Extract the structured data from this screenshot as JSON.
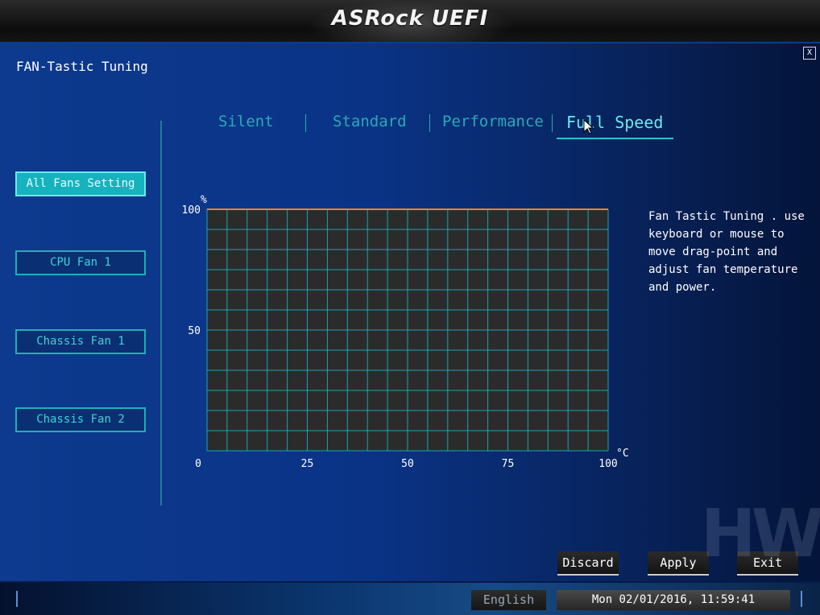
{
  "header": {
    "logo_text": "ASRock UEFI"
  },
  "page": {
    "title": "FAN-Tastic Tuning",
    "close_label": "X"
  },
  "sidebar": {
    "items": [
      {
        "label": "All Fans Setting",
        "active": true
      },
      {
        "label": "CPU Fan 1",
        "active": false
      },
      {
        "label": "Chassis Fan 1",
        "active": false
      },
      {
        "label": "Chassis Fan 2",
        "active": false
      }
    ]
  },
  "tabs": [
    {
      "label": "Silent",
      "active": false
    },
    {
      "label": "Standard",
      "active": false
    },
    {
      "label": "Performance",
      "active": false
    },
    {
      "label": "Full Speed",
      "active": true
    }
  ],
  "chart_data": {
    "type": "line",
    "x_unit_label": "°C",
    "y_unit_label": "%",
    "xlim": [
      0,
      100
    ],
    "ylim": [
      0,
      100
    ],
    "x_ticks": [
      0,
      25,
      50,
      75,
      100
    ],
    "y_ticks": [
      0,
      50,
      100
    ],
    "grid": true,
    "series": [
      {
        "x": [
          0,
          100
        ],
        "y": [
          100,
          100
        ]
      }
    ]
  },
  "help": {
    "text": "Fan Tastic Tuning . use\nkeyboard or mouse to\nmove drag-point and\nadjust fan temperature\nand power."
  },
  "actions": {
    "discard": "Discard",
    "apply": "Apply",
    "exit": "Exit"
  },
  "footer": {
    "language": "English",
    "datetime": "Mon 02/01/2016, 11:59:41"
  },
  "watermark": {
    "text": "HW"
  },
  "colors": {
    "accent": "#2ec3cd",
    "active_button": "#16b2bd",
    "curve": "#e8862a",
    "grid": "#1fb6c8",
    "plot_bg": "#2b2b2b"
  }
}
